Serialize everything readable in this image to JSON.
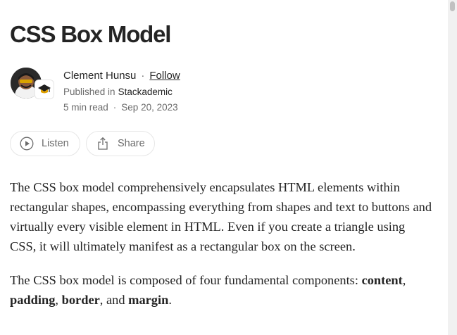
{
  "article": {
    "title": "CSS Box Model"
  },
  "author": {
    "name": "Clement Hunsu",
    "separator": "·",
    "follow_label": "Follow",
    "published_in_prefix": "Published in",
    "publication": "Stackademic",
    "read_time": "5 min read",
    "date_separator": "·",
    "date": "Sep 20, 2023"
  },
  "actions": {
    "listen_label": "Listen",
    "listen_icon": "play-circle-icon",
    "share_label": "Share",
    "share_icon": "share-icon"
  },
  "body": {
    "paragraph1": "The CSS box model comprehensively encapsulates HTML elements within rectangular shapes, encompassing everything from shapes and text to buttons and virtually every visible element in HTML. Even if you create a triangle using CSS, it will ultimately manifest as a rectangular box on the screen.",
    "paragraph2_intro": "The CSS box model is composed of four fundamental components:",
    "components": [
      "content",
      "padding",
      "border",
      "margin"
    ],
    "comma1": ", ",
    "comma2": ", ",
    "and_text": ", and ",
    "period": "."
  },
  "colors": {
    "text_primary": "#242424",
    "text_secondary": "#6b6b6b",
    "border": "#e6e6e6"
  }
}
